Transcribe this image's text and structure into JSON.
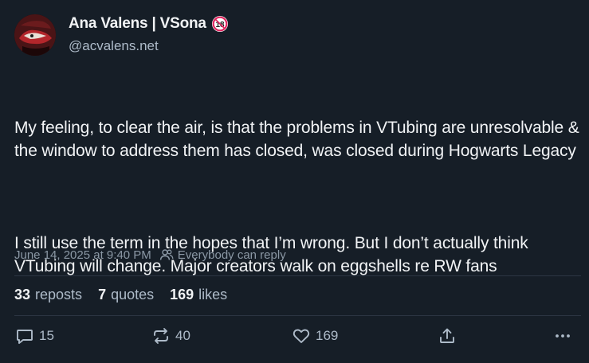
{
  "author": {
    "display_name": "Ana Valens | VSona",
    "handle": "@acvalens.net",
    "badge": "18"
  },
  "post": {
    "paragraphs": [
      "My feeling, to clear the air, is that the problems in VTubing are unresolvable & the window to address them has closed, was closed during Hogwarts Legacy",
      "I still use the term in the hopes that I’m wrong. But I don’t actually think VTubing will change. Major creators walk on eggshells re RW fans"
    ],
    "timestamp": "June 14, 2025 at 9:40 PM",
    "reply_setting": "Everybody can reply"
  },
  "stats": {
    "reposts_count": "33",
    "reposts_label": "reposts",
    "quotes_count": "7",
    "quotes_label": "quotes",
    "likes_count": "169",
    "likes_label": "likes"
  },
  "actions": {
    "reply_count": "15",
    "repost_count": "40",
    "like_count": "169"
  },
  "colors": {
    "background": "#161e27",
    "text": "#f1f3f5",
    "muted": "#aebbc9",
    "badge_red": "#e0245e"
  },
  "icons": [
    "avatar",
    "age-18-badge-icon",
    "people-icon",
    "reply-icon",
    "repost-icon",
    "heart-icon",
    "share-icon",
    "more-icon"
  ]
}
